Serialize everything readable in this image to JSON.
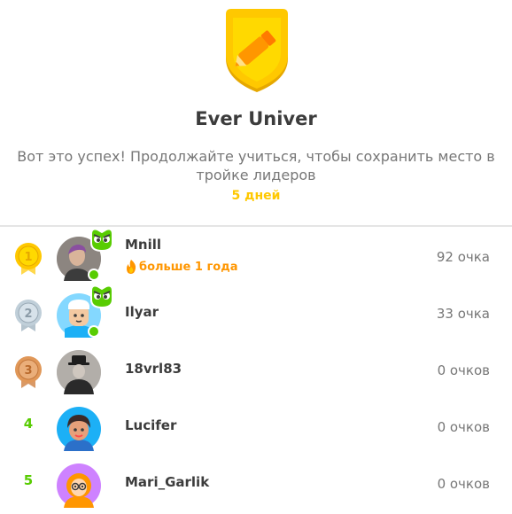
{
  "league": {
    "name": "Ever Univer",
    "message": "Вот это успех! Продолжайте учиться, чтобы сохранить место в тройке лидеров",
    "days_left": "5 дней",
    "badge_icon": "pencil-shield-icon",
    "badge_color": "#ffc800"
  },
  "leaderboard": [
    {
      "rank": "1",
      "medal": "gold",
      "username": "Mnill",
      "streak": "больше 1 года",
      "points": "92 очка",
      "online": true,
      "super": true
    },
    {
      "rank": "2",
      "medal": "silver",
      "username": "Ilyar",
      "points": "33 очка",
      "online": true,
      "super": true
    },
    {
      "rank": "3",
      "medal": "bronze",
      "username": "18vrl83",
      "points": "0 очков",
      "online": false,
      "super": false
    },
    {
      "rank": "4",
      "username": "Lucifer",
      "points": "0 очков",
      "online": false,
      "super": false
    },
    {
      "rank": "5",
      "username": "Mari_Garlik",
      "points": "0 очков",
      "online": false,
      "super": false
    }
  ],
  "colors": {
    "gold": "#ffc800",
    "silver": "#c0cfd9",
    "bronze": "#e09758",
    "green": "#58cc02",
    "orange": "#ff9600"
  }
}
